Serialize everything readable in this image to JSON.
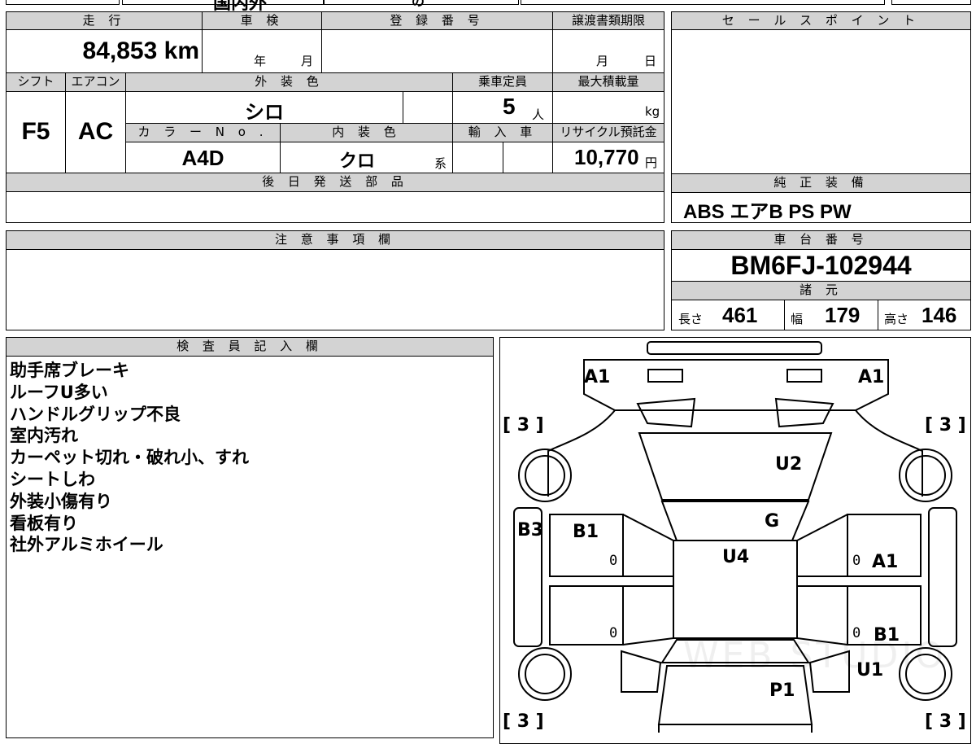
{
  "top_strip": {
    "partial_text": "国内外",
    "partial_mark": "の"
  },
  "mileage": {
    "header": "走 行",
    "value": "84,853 km"
  },
  "inspection": {
    "header": "車 検",
    "year_label": "年",
    "month_label": "月"
  },
  "registration": {
    "header": "登 録 番 号"
  },
  "transfer": {
    "header": "譲渡書類期限",
    "month_label": "月",
    "day_label": "日"
  },
  "sales_point": {
    "header": "セ ー ル ス ポ イ ン ト"
  },
  "shift": {
    "header": "シフト",
    "value": "F5"
  },
  "aircon": {
    "header": "エアコン",
    "value": "AC"
  },
  "exterior_color": {
    "header": "外 装 色",
    "value": "シロ"
  },
  "capacity": {
    "header": "乗車定員",
    "value": "5",
    "unit": "人"
  },
  "max_load": {
    "header": "最大積載量",
    "unit": "kg"
  },
  "color_no": {
    "header": "カ ラ ー N o .",
    "value": "A4D"
  },
  "interior_color": {
    "header": "内 装 色",
    "value": "クロ",
    "suffix": "系"
  },
  "import": {
    "header": "輸 入 車"
  },
  "recycle": {
    "header": "リサイクル預託金",
    "value": "10,770",
    "unit": "円"
  },
  "later_parts": {
    "header": "後 日 発 送 部 品"
  },
  "genuine_equipment": {
    "header": "純 正 装 備",
    "value": "ABS エアB PS PW"
  },
  "remarks": {
    "header": "注 意 事 項 欄"
  },
  "chassis": {
    "header": "車 台 番 号",
    "value": "BM6FJ-102944"
  },
  "specs": {
    "header": "諸 元",
    "length_label": "長さ",
    "length": "461",
    "width_label": "幅",
    "width": "179",
    "height_label": "高さ",
    "height": "146"
  },
  "inspector": {
    "header": "検 査 員 記 入 欄",
    "notes": [
      "助手席ブレーキ",
      "ルーフU多い",
      "ハンドルグリップ不良",
      "室内汚れ",
      "カーペット切れ・破れ小、すれ",
      "シートしわ",
      "外装小傷有り",
      "看板有り",
      "社外アルミホイール"
    ]
  },
  "diagram": {
    "front_left": "A1",
    "front_right": "A1",
    "tire_fl": "[ 3 ]",
    "tire_fr": "[ 3 ]",
    "tire_rl": "[ 3 ]",
    "tire_rr": "[ 3 ]",
    "hood": "U2",
    "windshield": "G",
    "roof": "U4",
    "left_rocker": "B3",
    "left_front_door": "B1",
    "right_front_door": "A1",
    "right_rear_door": "B1",
    "right_rear_fender": "U1",
    "trunk": "P1",
    "door_zero": "0",
    "watermark": "WEB STUDIO"
  }
}
